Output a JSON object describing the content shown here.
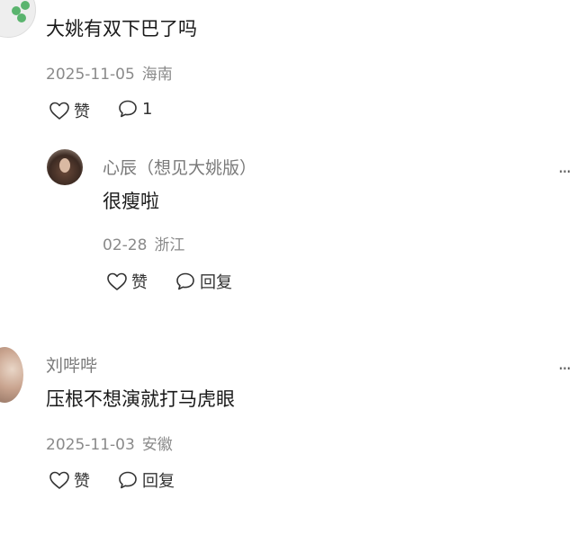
{
  "comments": [
    {
      "text": "大姚有双下巴了吗",
      "date": "2025-11-05",
      "location": "海南",
      "like_label": "赞",
      "reply_count": "1",
      "replies": [
        {
          "username": "心辰（想见大姚版）",
          "text": "很瘦啦",
          "date": "02-28",
          "location": "浙江",
          "like_label": "赞",
          "reply_label": "回复",
          "more_label": "..."
        }
      ]
    },
    {
      "username": "刘哔哔",
      "text": "压根不想演就打马虎眼",
      "date": "2025-11-03",
      "location": "安徽",
      "like_label": "赞",
      "reply_label": "回复",
      "more_label": "..."
    }
  ],
  "icons": {
    "like": "heart-outline-icon",
    "comment": "speech-bubble-icon"
  },
  "colors": {
    "meta_text": "#8a8a8a",
    "username_text": "#7a7a7a",
    "body_text": "#1a1a1a"
  }
}
